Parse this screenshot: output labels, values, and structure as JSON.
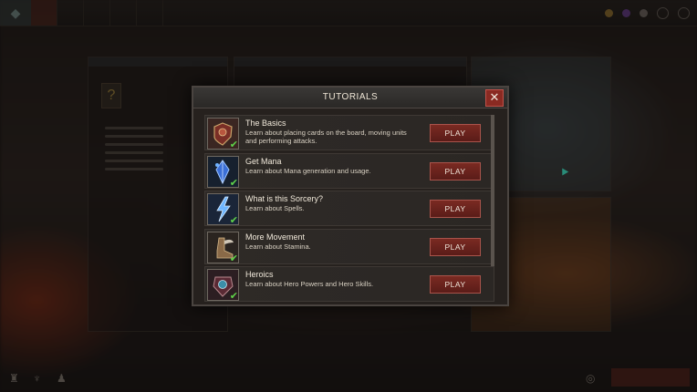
{
  "modal": {
    "title": "TUTORIALS",
    "close_glyph": "✕",
    "tutorials": [
      {
        "title": "The Basics",
        "description": "Learn about placing cards on the board, moving units and performing attacks.",
        "play_label": "PLAY",
        "completed": true,
        "icon": "shield-warrior-icon"
      },
      {
        "title": "Get Mana",
        "description": "Learn about Mana generation and usage.",
        "play_label": "PLAY",
        "completed": true,
        "icon": "mana-crystal-icon"
      },
      {
        "title": "What is this Sorcery?",
        "description": "Learn about Spells.",
        "play_label": "PLAY",
        "completed": true,
        "icon": "lightning-spell-icon"
      },
      {
        "title": "More Movement",
        "description": "Learn about Stamina.",
        "play_label": "PLAY",
        "completed": true,
        "icon": "winged-boot-icon"
      },
      {
        "title": "Heroics",
        "description": "Learn about Hero Powers and Hero Skills.",
        "play_label": "PLAY",
        "completed": true,
        "icon": "hero-armor-icon"
      }
    ],
    "check_glyph": "✔"
  },
  "colors": {
    "accent_red": "#7a2a22",
    "check_green": "#5fd34a"
  }
}
